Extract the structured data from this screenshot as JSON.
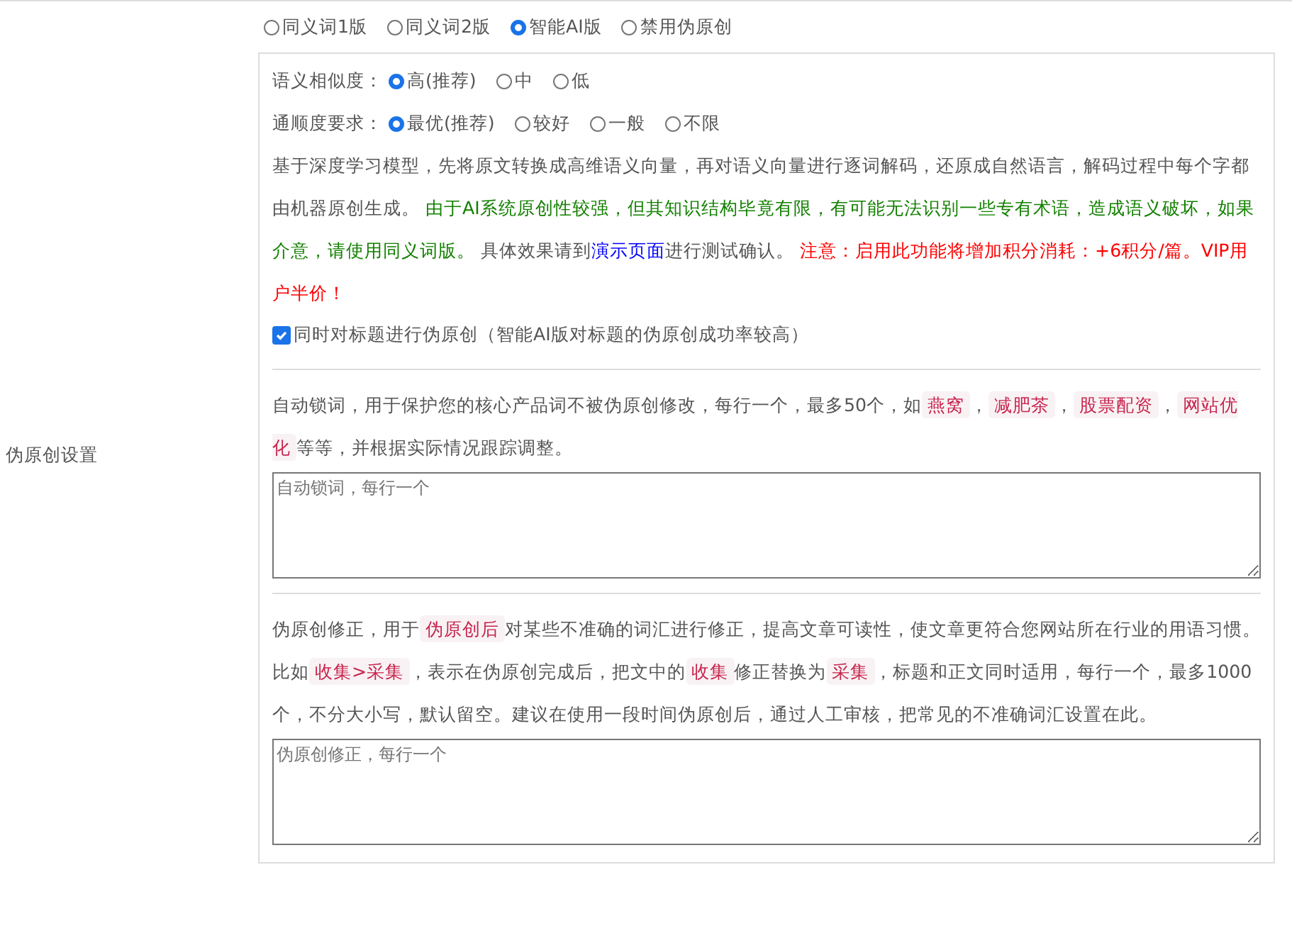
{
  "side_label": "伪原创设置",
  "mode_options": [
    {
      "label": "同义词1版",
      "selected": false
    },
    {
      "label": "同义词2版",
      "selected": false
    },
    {
      "label": "智能AI版",
      "selected": true
    },
    {
      "label": "禁用伪原创",
      "selected": false
    }
  ],
  "settings": [
    {
      "label": "语义相似度：",
      "options": [
        {
          "label": "高(推荐)",
          "selected": true
        },
        {
          "label": "中",
          "selected": false
        },
        {
          "label": "低",
          "selected": false
        }
      ]
    },
    {
      "label": "通顺度要求：",
      "options": [
        {
          "label": "最优(推荐)",
          "selected": true
        },
        {
          "label": "较好",
          "selected": false
        },
        {
          "label": "一般",
          "selected": false
        },
        {
          "label": "不限",
          "selected": false
        }
      ]
    }
  ],
  "description": [
    {
      "kind": "plain",
      "text": "基于深度学习模型，先将原文转换成高维语义向量，再对语义向量进行逐词解码，还原成自然语言，解码过程中每个字都由机器原创生成。 "
    },
    {
      "kind": "success",
      "text": "由于AI系统原创性较强，但其知识结构毕竟有限，有可能无法识别一些专有术语，造成语义破坏，如果介意，请使用同义词版。"
    },
    {
      "kind": "plain",
      "text": " 具体效果请到"
    },
    {
      "kind": "link",
      "text": "演示页面"
    },
    {
      "kind": "plain",
      "text": "进行测试确认。 "
    },
    {
      "kind": "warning",
      "text": "注意：启用此功能将增加积分消耗：+6积分/篇。VIP用户半价！"
    }
  ],
  "title_option": {
    "label": "同时对标题进行伪原创（智能AI版对标题的伪原创成功率较高）",
    "checked": true
  },
  "lock_words": {
    "description": [
      {
        "kind": "plain",
        "text": "自动锁词，用于保护您的核心产品词不被伪原创修改，每行一个，最多50个，如"
      },
      {
        "kind": "code",
        "text": "燕窝"
      },
      {
        "kind": "plain",
        "text": "，"
      },
      {
        "kind": "code",
        "text": "减肥茶"
      },
      {
        "kind": "plain",
        "text": "，"
      },
      {
        "kind": "code",
        "text": "股票配资"
      },
      {
        "kind": "plain",
        "text": "，"
      },
      {
        "kind": "code",
        "text": "网站优化"
      },
      {
        "kind": "plain",
        "text": "等等，并根据实际情况跟踪调整。"
      }
    ],
    "placeholder": "自动锁词，每行一个"
  },
  "corrections": {
    "description": [
      {
        "kind": "plain",
        "text": "伪原创修正，用于"
      },
      {
        "kind": "code",
        "text": "伪原创后"
      },
      {
        "kind": "plain",
        "text": "对某些不准确的词汇进行修正，提高文章可读性，使文章更符合您网站所在行业的用语习惯。比如"
      },
      {
        "kind": "code",
        "text": "收集>采集"
      },
      {
        "kind": "plain",
        "text": "，表示在伪原创完成后，把文中的"
      },
      {
        "kind": "code",
        "text": "收集"
      },
      {
        "kind": "plain",
        "text": "修正替换为"
      },
      {
        "kind": "code",
        "text": "采集"
      },
      {
        "kind": "plain",
        "text": "，标题和正文同时适用，每行一个，最多1000个，不分大小写，默认留空。建议在使用一段时间伪原创后，通过人工审核，把常见的不准确词汇设置在此。"
      }
    ],
    "placeholder": "伪原创修正，每行一个"
  }
}
